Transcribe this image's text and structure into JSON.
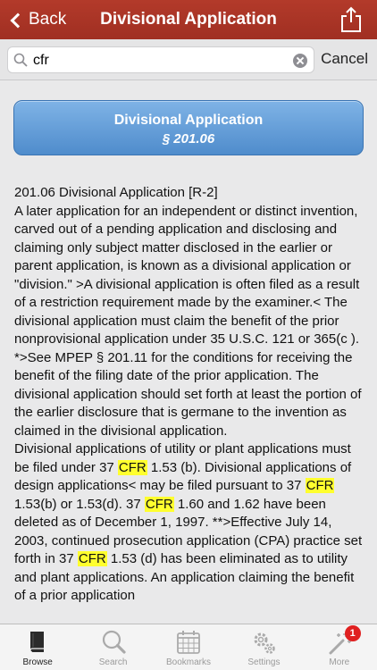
{
  "nav": {
    "back_label": "Back",
    "title": "Divisional Application",
    "share_icon": "share-icon"
  },
  "search": {
    "value": "cfr",
    "cancel_label": "Cancel"
  },
  "section": {
    "title": "Divisional Application",
    "number": "§ 201.06"
  },
  "content": {
    "heading": "201.06 Divisional Application [R-2]",
    "p1": "A later application for an independent or distinct invention, carved out of a pending application and disclosing and claiming only subject matter disclosed in the earlier or parent application, is known as a divisional application or \"division.\" >A divisional application is often filed as a result of a restriction requirement made by the examiner.< The divisional application must claim the benefit of the prior nonprovisional application under 35 U.S.C. 121 or 365(c ). *>See MPEP § 201.11 for the conditions for receiving the benefit of the filing date of the prior application. The divisional application should set forth at least the portion of the earlier disclosure that is germane to the invention as claimed in the divisional application.",
    "highlight": "CFR",
    "p2_a": "Divisional applications of utility or plant applications must be filed under 37 ",
    "p2_b": " 1.53 (b). Divisional applications of design applications< may be filed pursuant to 37 ",
    "p2_c": " 1.53(b) or 1.53(d). 37 ",
    "p2_d": " 1.60 and 1.62 have been deleted as of December 1, 1997. **>Effective July 14, 2003, continued prosecution application (CPA) practice set forth in 37 ",
    "p2_e": " 1.53 (d) has been eliminated as to utility and plant applications. An application claiming the benefit of a prior application"
  },
  "tabs": [
    {
      "label": "Browse",
      "icon": "book-icon",
      "active": true
    },
    {
      "label": "Search",
      "icon": "magnifier-icon"
    },
    {
      "label": "Bookmarks",
      "icon": "calendar-icon"
    },
    {
      "label": "Settings",
      "icon": "gear-icon"
    },
    {
      "label": "More",
      "icon": "magic-wand-icon",
      "badge": "1"
    }
  ],
  "colors": {
    "navbar": "#a93427",
    "button": "#5b97d4",
    "highlight": "#ffff2e",
    "badge": "#e02020"
  }
}
